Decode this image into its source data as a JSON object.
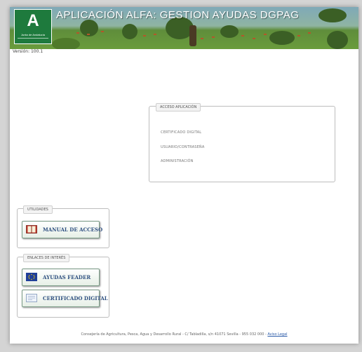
{
  "header": {
    "title": "APLICACIÓN ALFA: GESTION AYUDAS DGPAG",
    "logo_text": "Junta de Andalucía",
    "logo_letter": "A"
  },
  "version": "Versión: 100.1",
  "acceso": {
    "legend": "ACCESO APLICACIÓN",
    "options": [
      "CERTIFICADO DIGITAL",
      "USUARIO/CONTRASEÑA",
      "ADMINISTRACIÓN"
    ]
  },
  "utilidades": {
    "legend": "UTILIDADES",
    "manual_label": "MANUAL DE ACCESO"
  },
  "enlaces": {
    "legend": "ENLACES DE INTERÉS",
    "feader_label": "AYUDAS FEADER",
    "certificado_label": "CERTIFICADO DIGITAL"
  },
  "footer": {
    "text": "Consejería de Agricultura, Pesca, Agua y Desarrollo Rural - C/ Tabladilla, s/n 41071 Sevilla - 955 032 000 - ",
    "link": "Aviso Legal"
  },
  "colors": {
    "logo_green": "#1e7a3d",
    "button_text": "#2e4f80",
    "link": "#2a5aa8"
  }
}
